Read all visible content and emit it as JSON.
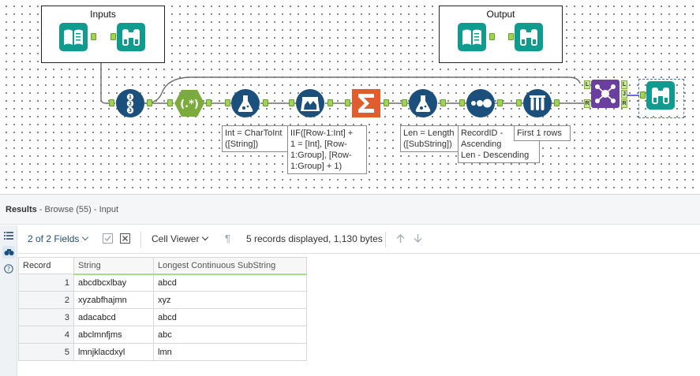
{
  "canvas": {
    "containers": [
      {
        "title": "Inputs"
      },
      {
        "title": "Output"
      }
    ],
    "colors": {
      "teal": "#0f9b8e",
      "navy": "#1b4f7c",
      "green": "#7aab3c",
      "orange": "#e05e2d",
      "purple": "#6b3fa0",
      "connector": "#707070",
      "anchor": "#9fd356"
    },
    "tools": [
      {
        "name": "input-data-tool",
        "icon": "book-icon"
      },
      {
        "name": "browse-tool",
        "icon": "binoculars-icon"
      },
      {
        "name": "text-input-tool",
        "icon": "book-icon"
      },
      {
        "name": "browse-tool",
        "icon": "binoculars-icon"
      },
      {
        "name": "record-id-tool",
        "icon": "numbered-list-icon"
      },
      {
        "name": "regex-tool",
        "icon": "regex-icon"
      },
      {
        "name": "formula-tool",
        "icon": "flask-icon"
      },
      {
        "name": "multi-row-formula-tool",
        "icon": "multi-flask-icon"
      },
      {
        "name": "summarize-tool",
        "icon": "sigma-icon"
      },
      {
        "name": "formula-tool",
        "icon": "flask-icon"
      },
      {
        "name": "sort-tool",
        "icon": "dots-icon"
      },
      {
        "name": "sample-tool",
        "icon": "test-tubes-icon"
      },
      {
        "name": "join-tool",
        "icon": "join-icon"
      },
      {
        "name": "browse-tool",
        "icon": "binoculars-icon"
      }
    ],
    "anchor_labels": {
      "L": "L",
      "R": "R",
      "J": "J"
    },
    "annotations": {
      "formula1": "Int = CharToInt\n([String])",
      "multirow": "IIF([Row-1:Int] +\n1 = [Int], [Row-\n1:Group], [Row-\n1:Group] + 1)",
      "formula2": "Len = Length\n([SubString])",
      "sort": "RecordID -\nAscending\nLen - Descending",
      "sample": "First 1 rows"
    }
  },
  "results": {
    "title_bold": "Results",
    "title_rest": " - Browse (55) - Input",
    "fields_selector": "2 of 2 Fields",
    "cell_viewer": "Cell Viewer",
    "status": "5 records displayed, 1,130 bytes",
    "side_icons": [
      "list-icon",
      "binoculars-icon",
      "help-icon"
    ],
    "columns": [
      "Record",
      "String",
      "Longest Continuous SubString"
    ],
    "rows": [
      {
        "record": "1",
        "string": "abcdbcxlbay",
        "longest": "abcd"
      },
      {
        "record": "2",
        "string": "xyzabfhajmn",
        "longest": "xyz"
      },
      {
        "record": "3",
        "string": "adacabcd",
        "longest": "abcd"
      },
      {
        "record": "4",
        "string": "abclmnfjms",
        "longest": "abc"
      },
      {
        "record": "5",
        "string": "lmnjklacdxyl",
        "longest": "lmn"
      }
    ]
  }
}
